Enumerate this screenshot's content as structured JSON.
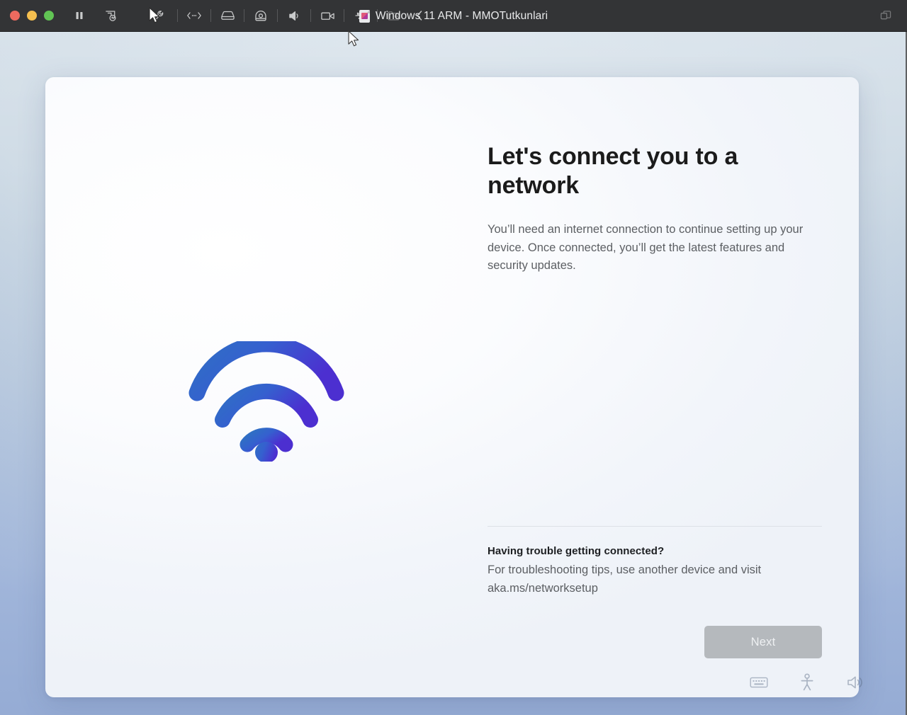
{
  "window": {
    "title": "Windows 11 ARM - MMOTutkunlari",
    "doc_icon": "vm-document-icon",
    "traffic_lights": [
      {
        "name": "close",
        "color": "#ed6a5f"
      },
      {
        "name": "minimize",
        "color": "#f5bf4f"
      },
      {
        "name": "maximize",
        "color": "#61c454"
      }
    ],
    "toolbar_icons": [
      {
        "name": "pause-icon",
        "label": "Pause"
      },
      {
        "name": "snapshot-icon",
        "label": "Snapshot"
      },
      {
        "name": "settings-wrench-icon",
        "label": "Settings"
      },
      {
        "name": "network-icon",
        "label": "Network Adapter"
      },
      {
        "name": "hard-disk-icon",
        "label": "Hard Disk"
      },
      {
        "name": "camera-icon",
        "label": "Camera"
      },
      {
        "name": "sound-icon",
        "label": "Sound Card"
      },
      {
        "name": "video-camera-icon",
        "label": "Video"
      },
      {
        "name": "usb-icon",
        "label": "USB Controller"
      },
      {
        "name": "shared-folder-icon",
        "label": "Shared Folders"
      },
      {
        "name": "collapse-chevron-icon",
        "label": "Collapse"
      }
    ],
    "right_icon": {
      "name": "window-overlap-icon",
      "label": "Full Screen"
    }
  },
  "oobe": {
    "headline": "Let's connect you to a network",
    "subtext": "You’ll need an internet connection to continue setting up your device. Once connected, you’ll get the latest features and security updates.",
    "trouble_title": "Having trouble getting connected?",
    "trouble_body": "For troubleshooting tips, use another device and visit aka.ms/networksetup",
    "next_label": "Next",
    "next_enabled": false,
    "illustration": "wifi-icon",
    "accent_gradient_start": "#2f6fc4",
    "accent_gradient_end": "#4c2fd0"
  },
  "tray": [
    {
      "name": "keyboard-icon",
      "label": "Ease of access keyboard"
    },
    {
      "name": "accessibility-icon",
      "label": "Ease of access"
    },
    {
      "name": "volume-icon",
      "label": "Narrator volume"
    }
  ],
  "colors": {
    "titlebar_bg": "#333436",
    "desktop_bg": "#ccd9e4",
    "card_bg": "#f7f9fc",
    "text_primary": "#1b1b1b",
    "text_secondary": "#5c5f63",
    "button_disabled": "#b5b9bd"
  }
}
